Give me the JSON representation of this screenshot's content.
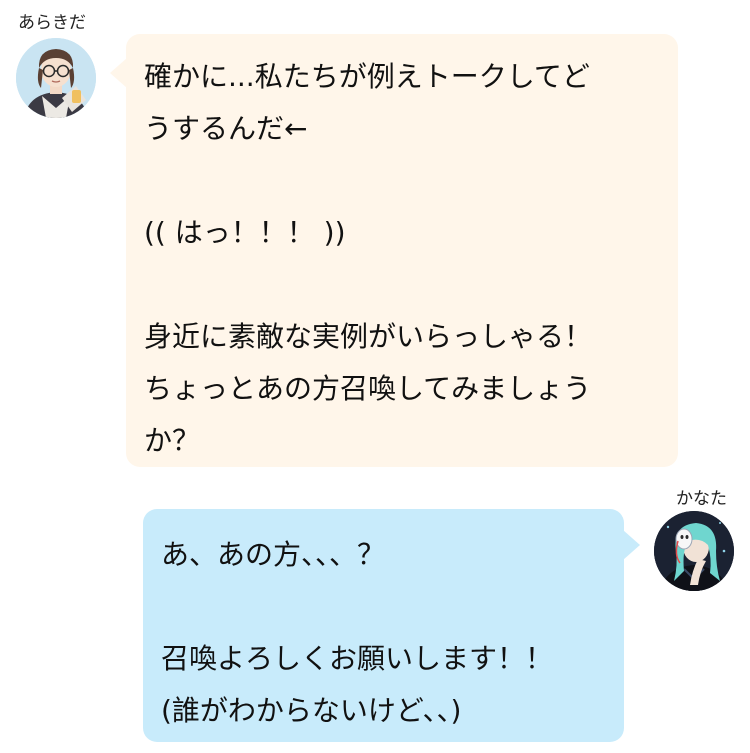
{
  "messages": [
    {
      "sender": "あらきだ",
      "side": "left",
      "avatar": "glasses-person-avatar",
      "bubble_color": "#fff6ea",
      "lines": [
        "確かに...私たちが例えトークしてど",
        "うするんだ←",
        "",
        "(( はっ！！！ ))",
        "",
        "身近に素敵な実例がいらっしゃる！",
        "ちょっとあの方召喚してみましょう",
        "か？"
      ]
    },
    {
      "sender": "かなた",
      "side": "right",
      "avatar": "masked-teal-hair-avatar",
      "bubble_color": "#c8ebfb",
      "lines": [
        "あ、あの方、、、？",
        "",
        "召喚よろしくお願いします！！",
        "(誰がわからないけど、、)"
      ]
    }
  ]
}
